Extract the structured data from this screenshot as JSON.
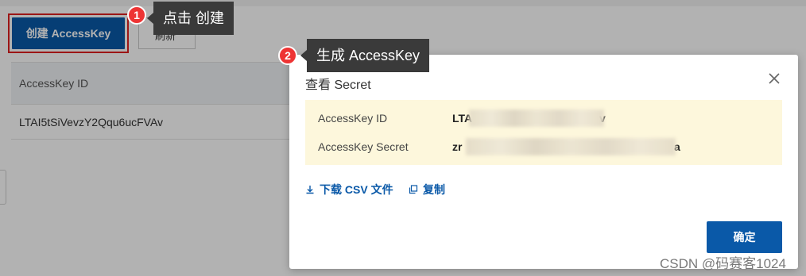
{
  "toolbar": {
    "create_label": "创建 AccessKey",
    "refresh_label": "刷新"
  },
  "table": {
    "header": "AccessKey ID",
    "rows": [
      "LTAI5tSiVevzY2Qqu6ucFVAv"
    ]
  },
  "annotations": {
    "step1": {
      "number": "1",
      "text": "点击 创建"
    },
    "step2": {
      "number": "2",
      "text": "生成 AccessKey"
    }
  },
  "dialog": {
    "title": "查看 Secret",
    "fields": [
      {
        "label": "AccessKey ID",
        "value_start": "LTA",
        "value_end": "v"
      },
      {
        "label": "AccessKey Secret",
        "value_start": "zr",
        "value_end": "a"
      }
    ],
    "download_label": "下载 CSV 文件",
    "copy_label": "复制",
    "ok_label": "确定"
  },
  "watermark": "CSDN @码赛客1024",
  "icons": {
    "close": "close-icon",
    "download": "download-icon",
    "copy": "copy-icon"
  },
  "colors": {
    "primary": "#0a59a8",
    "highlight": "#e02020",
    "badge": "#ee3434",
    "info_bg": "#fdf7dc"
  }
}
